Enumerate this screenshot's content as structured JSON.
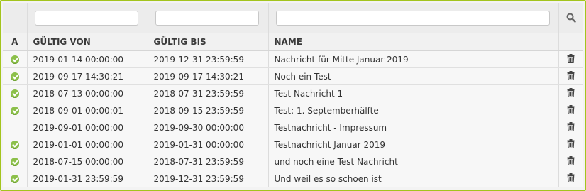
{
  "filters": {
    "von": "",
    "bis": "",
    "name": ""
  },
  "columns": {
    "active": "A",
    "valid_from": "GÜLTIG VON",
    "valid_to": "GÜLTIG BIS",
    "name": "NAME"
  },
  "rows": [
    {
      "active": true,
      "valid_from": "2019-01-14 00:00:00",
      "valid_to": "2019-12-31 23:59:59",
      "name": "Nachricht für Mitte Januar 2019"
    },
    {
      "active": true,
      "valid_from": "2019-09-17 14:30:21",
      "valid_to": "2019-09-17 14:30:21",
      "name": "Noch ein Test"
    },
    {
      "active": true,
      "valid_from": "2018-07-13 00:00:00",
      "valid_to": "2018-07-31 23:59:59",
      "name": "Test Nachricht 1"
    },
    {
      "active": true,
      "valid_from": "2018-09-01 00:00:01",
      "valid_to": "2018-09-15 23:59:59",
      "name": "Test: 1. Septemberhälfte"
    },
    {
      "active": false,
      "valid_from": "2019-09-01 00:00:00",
      "valid_to": "2019-09-30 00:00:00",
      "name": "Testnachricht - Impressum"
    },
    {
      "active": true,
      "valid_from": "2019-01-01 00:00:00",
      "valid_to": "2019-01-31 00:00:00",
      "name": "Testnachricht Januar 2019"
    },
    {
      "active": true,
      "valid_from": "2018-07-15 00:00:00",
      "valid_to": "2018-07-31 23:59:59",
      "name": "und noch eine Test Nachricht"
    },
    {
      "active": true,
      "valid_from": "2019-01-31 23:59:59",
      "valid_to": "2019-12-31 23:59:59",
      "name": "Und weil es so schoen ist"
    }
  ],
  "icons": {
    "search": "search-icon",
    "delete": "trash-icon",
    "active": "check-circle-icon"
  },
  "colors": {
    "frame": "#a3c41d",
    "check": "#8cc04a"
  }
}
